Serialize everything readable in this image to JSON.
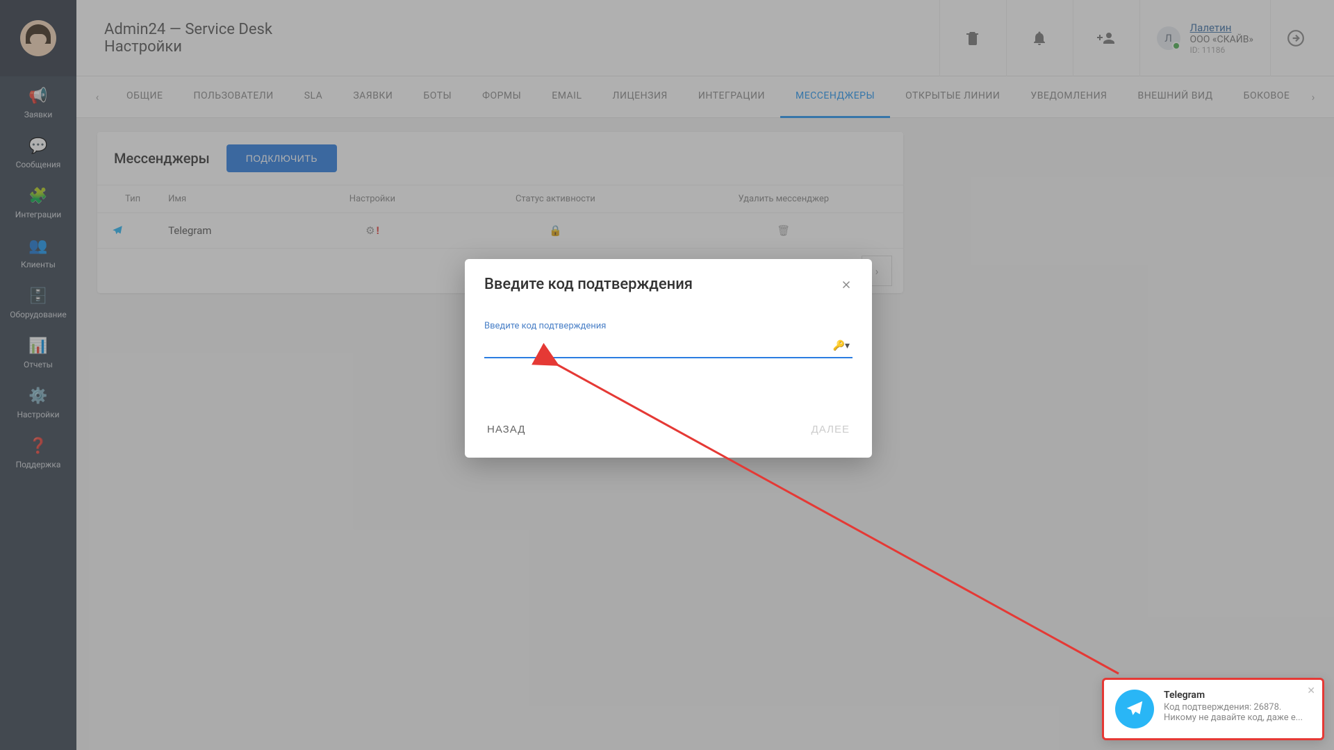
{
  "header": {
    "title": "Admin24 — Service Desk",
    "subtitle": "Настройки",
    "user": {
      "badge": "Л",
      "name": "Лалетин",
      "org": "ООО «СКАЙВ»",
      "id": "ID: 11186"
    }
  },
  "sidebar": {
    "items": [
      {
        "label": "Заявки",
        "icon": "📢"
      },
      {
        "label": "Сообщения",
        "icon": "💬"
      },
      {
        "label": "Интеграции",
        "icon": "🧩"
      },
      {
        "label": "Клиенты",
        "icon": "👥"
      },
      {
        "label": "Оборудование",
        "icon": "🗄️"
      },
      {
        "label": "Отчеты",
        "icon": "📊"
      },
      {
        "label": "Настройки",
        "icon": "⚙️"
      },
      {
        "label": "Поддержка",
        "icon": "❓"
      }
    ]
  },
  "tabs": {
    "items": [
      "ОБЩИЕ",
      "ПОЛЬЗОВАТЕЛИ",
      "SLA",
      "ЗАЯВКИ",
      "БОТЫ",
      "ФОРМЫ",
      "EMAIL",
      "ЛИЦЕНЗИЯ",
      "ИНТЕГРАЦИИ",
      "МЕССЕНДЖЕРЫ",
      "ОТКРЫТЫЕ ЛИНИИ",
      "УВЕДОМЛЕНИЯ",
      "ВНЕШНИЙ ВИД",
      "БОКОВОЕ"
    ],
    "active_index": 9
  },
  "card": {
    "title": "Мессенджеры",
    "connect_button": "ПОДКЛЮЧИТЬ",
    "columns": [
      "Тип",
      "Имя",
      "Настройки",
      "Статус активности",
      "Удалить мессенджер"
    ],
    "rows": [
      {
        "name": "Telegram"
      }
    ]
  },
  "modal": {
    "title": "Введите код подтверждения",
    "input_label": "Введите код подтверждения",
    "value": "",
    "back": "НАЗАД",
    "next": "ДАЛЕЕ"
  },
  "toast": {
    "title": "Telegram",
    "line1_prefix": "Код подтверждения: ",
    "code": "26878",
    "line2": "Никому не давайте код, даже е..."
  }
}
